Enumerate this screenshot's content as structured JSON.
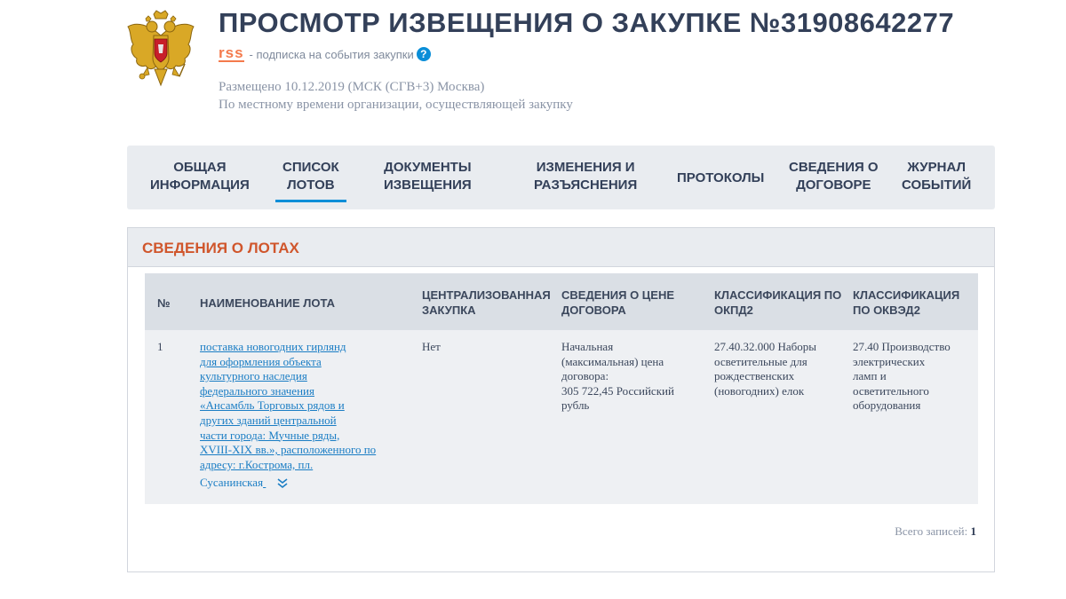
{
  "header": {
    "title": "ПРОСМОТР ИЗВЕЩЕНИЯ О ЗАКУПКЕ №31908642277",
    "rss_label": "rss",
    "rss_text": "- подписка на события закупки",
    "help_label": "?",
    "posted_line": "Размещено 10.12.2019 (МСК (СГВ+3) Москва)",
    "local_time_note": "По местному времени организации, осуществляющей закупку"
  },
  "tabs": [
    {
      "line1": "Общая",
      "line2": "информация"
    },
    {
      "line1": "Список",
      "line2": "лотов"
    },
    {
      "line1": "Документы",
      "line2": "извещения"
    },
    {
      "line1": "Изменения и",
      "line2": "разъяснения"
    },
    {
      "line1": "Протоколы",
      "line2": ""
    },
    {
      "line1": "Сведения о",
      "line2": "договоре"
    },
    {
      "line1": "Журнал",
      "line2": "событий"
    }
  ],
  "active_tab": "Список лотов",
  "lots_section": {
    "title": "СВЕДЕНИЯ О ЛОТАХ",
    "columns": {
      "number": "№",
      "name": "Наименование лота",
      "centralized_1": "Централизованная",
      "centralized_2": "закупка",
      "price_1": "Сведения о цене",
      "price_2": "договора",
      "okpd_1": "Классификация по",
      "okpd_2": "ОКПД2",
      "okved_1": "Классификация",
      "okved_2": "по ОКВЭД2"
    },
    "rows": [
      {
        "number": "1",
        "name_lines": [
          "поставка новогодних гирлянд",
          "для оформления объекта",
          "культурного наследия",
          "федерального значения",
          "«Ансамбль Торговых рядов и",
          "других зданий центральной",
          "части города: Мучные ряды,",
          "XVIII-XIX вв.», расположенного по",
          "адресу: г.Кострома, пл.",
          "Сусанинская"
        ],
        "centralized": "Нет",
        "price_lines": [
          "Начальная",
          "(максимальная) цена",
          "договора:",
          "305 722,45 Российский",
          "рубль"
        ],
        "okpd_lines": [
          "27.40.32.000 Наборы",
          "осветительные для",
          "рождественских",
          "(новогодних) елок"
        ],
        "okved_lines": [
          "27.40 Производство",
          "электрических",
          "ламп и",
          "осветительного",
          "оборудования"
        ]
      }
    ],
    "total_label": "Всего записей:",
    "total_value": "1"
  },
  "colors": {
    "title": "#334059",
    "accent_blue": "#0a8ed8",
    "rss_orange": "#f47a4c",
    "section_title": "#d0562c",
    "link": "#1a7dc4"
  },
  "icons": [
    "russian-coat-of-arms-icon",
    "help-icon",
    "chevron-down-double-icon"
  ]
}
